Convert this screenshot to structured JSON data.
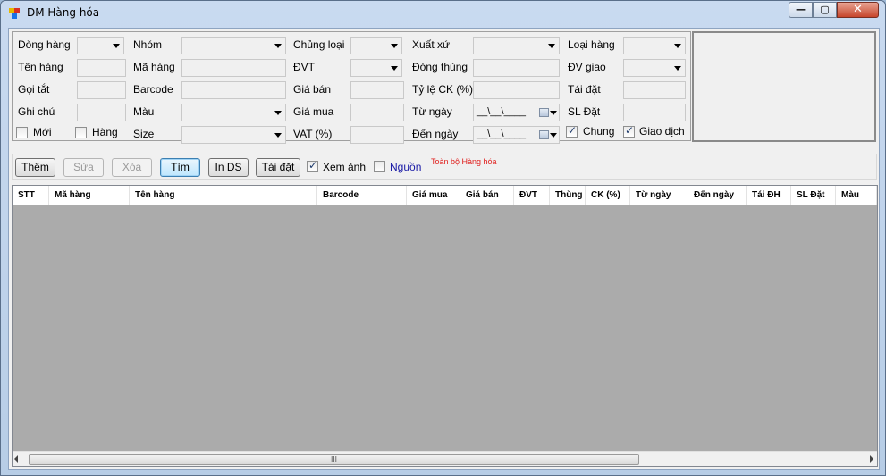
{
  "window": {
    "title": "DM Hàng hóa",
    "controls": {
      "minimize": "—",
      "maximize": "▢",
      "close": "✕"
    },
    "icon_colors": [
      "#e6b800",
      "#d93025",
      "#1a73e8"
    ]
  },
  "filters": {
    "col1": {
      "dong_hang": "Dòng hàng",
      "ten_hang": "Tên hàng",
      "goi_tat": "Gọi tắt",
      "ghi_chu": "Ghi chú",
      "moi": "Mới",
      "hang": "Hàng"
    },
    "col2": {
      "nhom": "Nhóm",
      "ma_hang": "Mã hàng",
      "barcode": "Barcode",
      "mau": "Màu",
      "size": "Size"
    },
    "col3": {
      "chung_loai": "Chủng loại",
      "dvt": "ĐVT",
      "gia_ban": "Giá bán",
      "gia_mua": "Giá mua",
      "vat": "VAT (%)"
    },
    "col4": {
      "xuat_xu": "Xuất xứ",
      "dong_thung": "Đóng thùng",
      "ty_le_ck": "Tỷ lệ CK (%)",
      "tu_ngay": "Từ ngày",
      "den_ngay": "Đến ngày",
      "date_mask": "__\\__\\____"
    },
    "col5": {
      "loai_hang": "Loại hàng",
      "dv_giao": "ĐV giao",
      "tai_dat": "Tái đặt",
      "sl_dat": "SL Đặt",
      "chung": "Chung",
      "giao_dich": "Giao dịch"
    }
  },
  "toolbar": {
    "them": "Thêm",
    "sua": "Sửa",
    "xoa": "Xóa",
    "tim": "Tìm",
    "in_ds": "In DS",
    "tai_dat": "Tái đặt",
    "xem_anh": "Xem ảnh",
    "nguon": "Nguồn",
    "status": "Toàn bộ Hàng hóa",
    "status_color": "#e0201e",
    "nguon_color": "#1a1aa6"
  },
  "grid": {
    "columns": [
      "STT",
      "Mã hàng",
      "Tên hàng",
      "Barcode",
      "Giá mua",
      "Giá bán",
      "ĐVT",
      "Thùng",
      "CK (%)",
      "Từ ngày",
      "Đến ngày",
      "Tái ĐH",
      "SL Đặt",
      "Màu"
    ],
    "scroll_grip": "III"
  }
}
